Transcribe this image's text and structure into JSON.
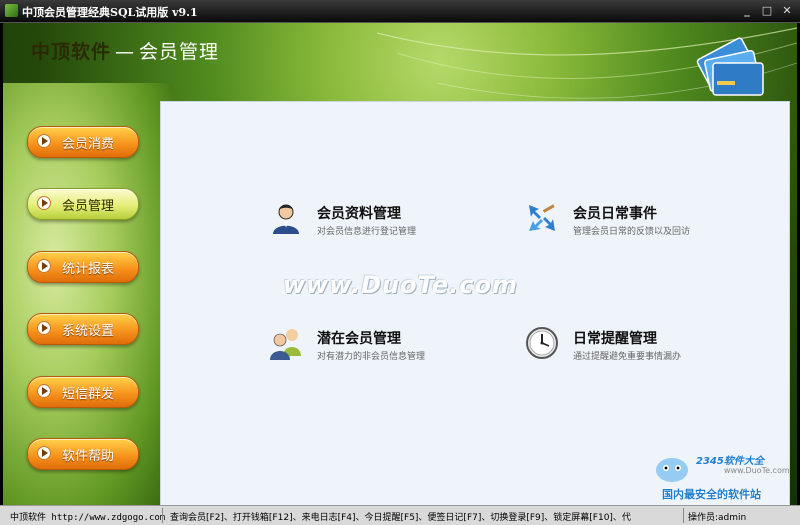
{
  "window": {
    "title": "中顶会员管理经典SQL试用版 v9.1"
  },
  "header": {
    "brand": "中顶软件",
    "dash": "—",
    "subtitle": "会员管理"
  },
  "nav": [
    {
      "label": "会员消费",
      "active": false
    },
    {
      "label": "会员管理",
      "active": true
    },
    {
      "label": "统计报表",
      "active": false
    },
    {
      "label": "系统设置",
      "active": false
    },
    {
      "label": "短信群发",
      "active": false
    },
    {
      "label": "软件帮助",
      "active": false
    }
  ],
  "features": [
    {
      "name": "会员资料管理",
      "desc": "对会员信息进行登记管理",
      "icon": "user-icon"
    },
    {
      "name": "会员日常事件",
      "desc": "管理会员日常的反馈以及回访",
      "icon": "arrows-icon"
    },
    {
      "name": "潜在会员管理",
      "desc": "对有潜力的非会员信息管理",
      "icon": "group-icon"
    },
    {
      "name": "日常提醒管理",
      "desc": "通过提醒避免重要事情漏办",
      "icon": "clock-icon"
    }
  ],
  "watermark": "www.DuoTe.com",
  "status": {
    "site": "中顶软件 http://www.zdgogo.com",
    "shortcuts": "查询会员[F2]、打开钱箱[F12]、来电日志[F4]、今日提醒[F5]、便签日记[F7]、切换登录[F9]、锁定屏幕[F10]、代",
    "operator": "操作员:admin"
  },
  "corner": {
    "logo": "2345软件大全",
    "url": "www.DuoTe.com",
    "slogan": "国内最安全的软件站"
  },
  "colors": {
    "panel_bg": "#eef4fa",
    "nav_orange": "#f7941d",
    "nav_active": "#e4ef7a",
    "title_bar": "#0a0a0a"
  }
}
